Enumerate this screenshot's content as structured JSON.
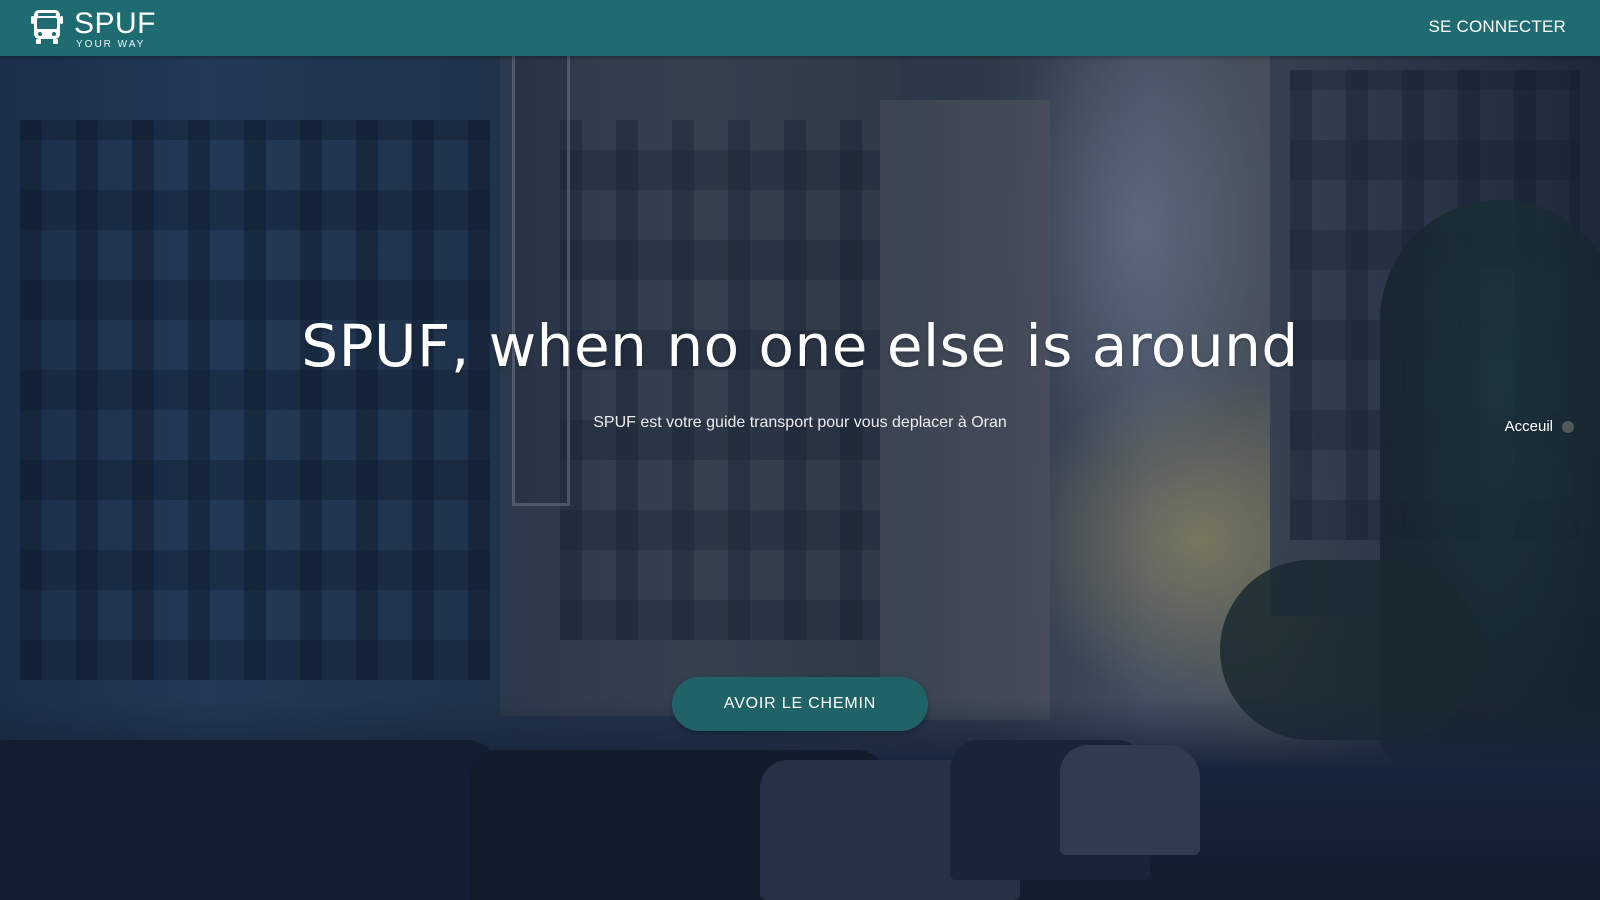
{
  "navbar": {
    "brand_name": "SPUF",
    "brand_tagline": "YOUR WAY",
    "brand_icon": "bus-icon",
    "login_label": "SE CONNECTER",
    "background_color": "#1f6b72"
  },
  "hero": {
    "title": "SPUF, when no one else is around",
    "subtitle": "SPUF est votre guide transport pour vous deplacer à Oran",
    "cta_label": "AVOIR LE CHEMIN",
    "cta_color": "#1f6366"
  },
  "side_nav": {
    "items": [
      {
        "label": "Acceuil"
      }
    ]
  }
}
